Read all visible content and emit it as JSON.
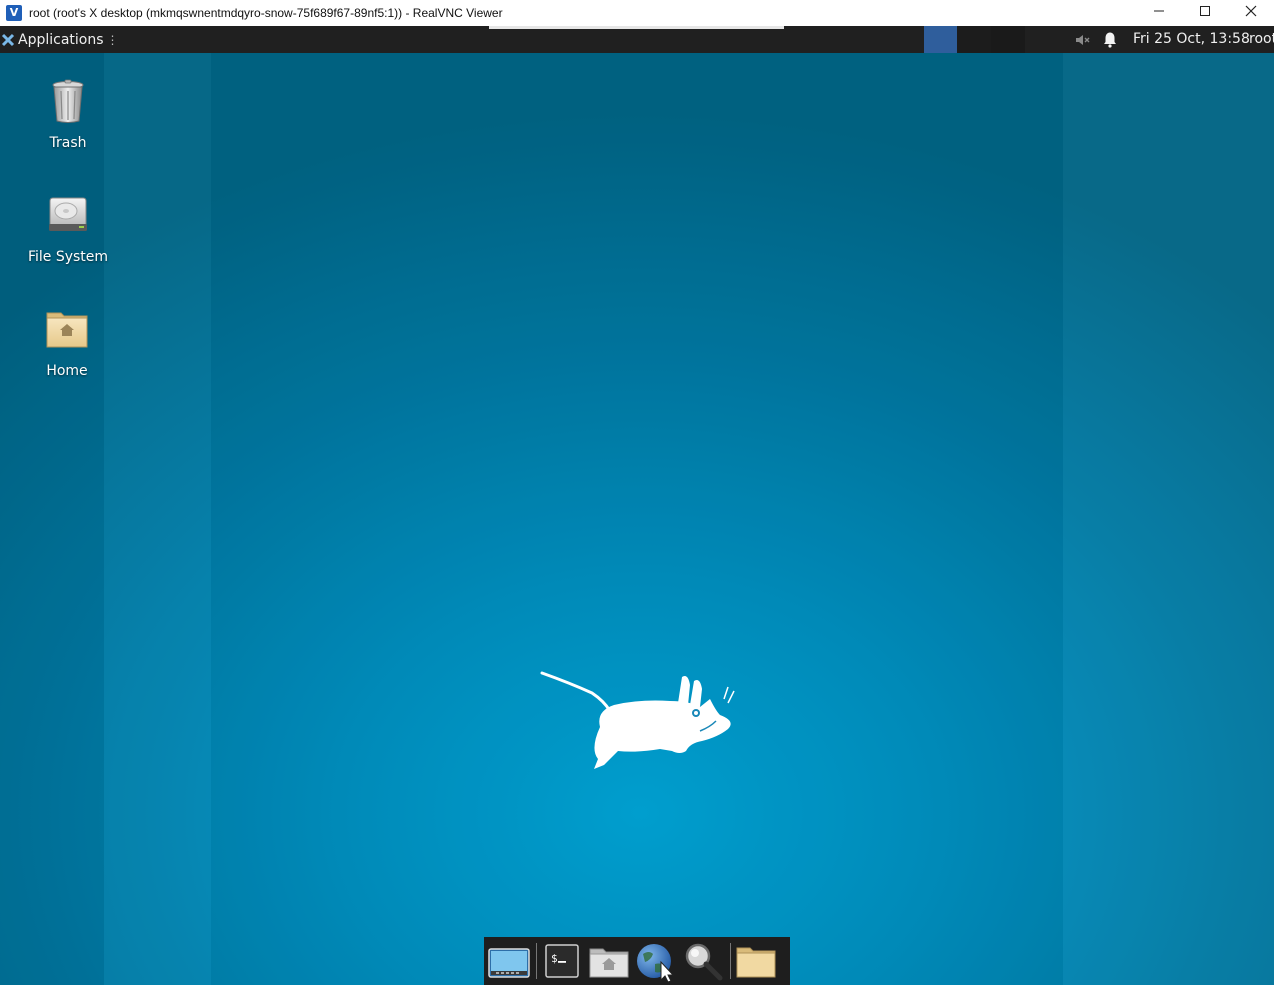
{
  "window": {
    "title": "root (root's X desktop (mkmqswnentmdqyro-snow-75f689f67-89nf5:1)) - RealVNC Viewer",
    "app_icon": "realvnc-icon",
    "controls": [
      "minimize-icon",
      "maximize-icon",
      "close-icon"
    ]
  },
  "top_panel": {
    "applications_label": "Applications",
    "clock": "Fri 25 Oct, 13:58",
    "user": "root",
    "tray_icons": [
      "volume-muted-icon",
      "notification-bell-icon"
    ]
  },
  "desktop": {
    "icons": [
      {
        "label": "Trash",
        "icon": "trash-icon"
      },
      {
        "label": "File System",
        "icon": "hard-drive-icon"
      },
      {
        "label": "Home",
        "icon": "home-folder-icon"
      }
    ],
    "wallpaper_logo": "xfce-mouse-logo"
  },
  "dock": {
    "items": [
      "show-desktop-icon",
      "terminal-icon",
      "file-manager-icon",
      "web-browser-icon",
      "app-finder-icon",
      "folder-icon"
    ]
  },
  "colors": {
    "panel_bg": "#202020",
    "desktop_center": "#00a6d8",
    "desktop_edge": "#006585",
    "active_workspace": "#2f5e9c"
  }
}
